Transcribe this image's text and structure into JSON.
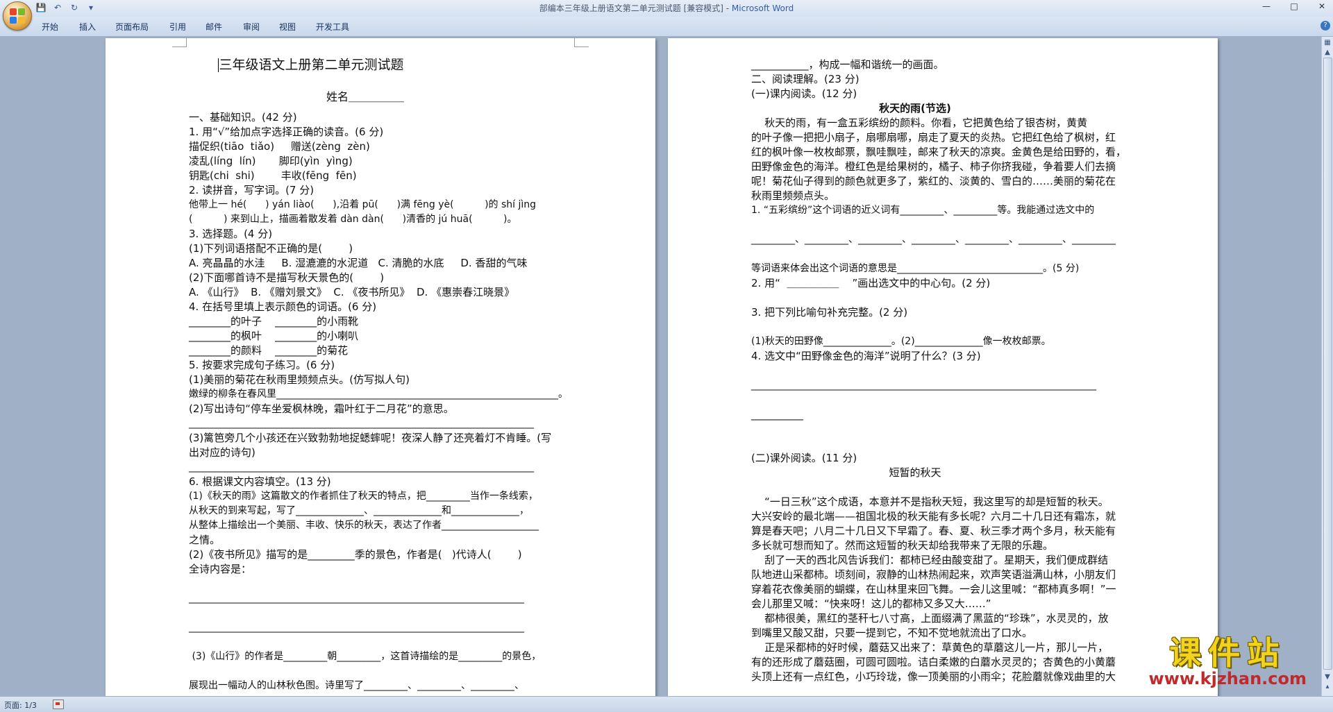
{
  "window": {
    "title": "部编本三年级上册语文第二单元测试题 [兼容模式] - ",
    "app_name": "Microsoft Word"
  },
  "ribbon": {
    "tabs": [
      "开始",
      "插入",
      "页面布局",
      "引用",
      "邮件",
      "审阅",
      "视图",
      "开发工具"
    ]
  },
  "status": {
    "page": "页面: 1/3"
  },
  "watermark": {
    "text": "课件站",
    "url": "www.kjzhan.com"
  },
  "page1": {
    "lines": [
      "三年级语文上册第二单元测试题",
      "姓名＿＿＿＿＿",
      "一、基础知识。(42 分)",
      "1. 用“√”给加点字选择正确的读音。(6 分)",
      "描促织(tiāo  tiǎo)     赠送(zèng  zèn)",
      "凌乱(líng  lín)       脚印(yìn  yìng)",
      "钥匙(chi  shi)        丰收(fēng  fēn)",
      "2. 读拼音，写字词。(7 分)",
      "他带上一 hé(      ) yán liào(      ),沿着 pū(      )满 fēng yè(          )的 shí jìng",
      "(          ) 来到山上，描画着散发着 dàn dàn(      )清香的 jú huā(          )。",
      "3. 选择题。(4 分)",
      "(1)下列词语搭配不正确的是(        )",
      "A. 亮晶晶的水洼     B. 湿漉漉的水泥道   C. 清脆的水底     D. 香甜的气味",
      "(2)下面哪首诗不是描写秋天景色的(        )",
      "A. 《山行》  B. 《赠刘景文》  C. 《夜书所见》  D. 《惠崇春江晓景》",
      "4. 在括号里填上表示颜色的词语。(6 分)",
      "________的叶子    ________的小雨靴",
      "________的枫叶    ________的小喇叭",
      "________的颜料    ________的菊花",
      "5. 按要求完成句子练习。(6 分)",
      "(1)美丽的菊花在秋雨里频频点头。(仿写拟人句)",
      "嫩绿的柳条在春风里__________________________________________________________。",
      "(2)写出诗句“停车坐爱枫林晚，霜叶红于二月花”的意思。",
      "_______________________________________________________________________",
      "(3)篱笆旁几个小孩还在兴致勃勃地捉蟋蟀呢！夜深人静了还亮着灯不肯睡。(写",
      "出对应的诗句)",
      "_______________________________________________________________________",
      "6. 根据课文内容填空。(13 分)",
      "(1)《秋天的雨》这篇散文的作者抓住了秋天的特点，把_________当作一条线索，",
      "从秋天的到来写起，写了______________、______________和______________，",
      "从整体上描绘出一个美丽、丰收、快乐的秋天，表达了作者____________________",
      "之情。",
      "(2)《夜书所见》描写的是_________季的景色，作者是(   )代诗人(        )",
      "全诗内容是：",
      "",
      "_____________________________________________________________________",
      "",
      "_____________________________________________________________________",
      "",
      " (3)《山行》的作者是_________朝_________，这首诗描绘的是_________的景色，",
      "",
      "展现出一幅动人的山林秋色图。诗里写了_________、_________、_________、"
    ]
  },
  "page2": {
    "lines": [
      "",
      "___________，构成一幅和谐统一的画面。",
      "二、阅读理解。(23 分)",
      "(一)课内阅读。(12 分)",
      "秋天的雨(节选)",
      "    秋天的雨，有一盒五彩缤纷的颜料。你看，它把黄色给了银杏树，黄黄",
      "的叶子像一把把小扇子，扇哪扇哪，扇走了夏天的炎热。它把红色给了枫树，红",
      "红的枫叶像一枚枚邮票，飘哇飘哇，邮来了秋天的凉爽。金黄色是给田野的，看，",
      "田野像金色的海洋。橙红色是给果树的，橘子、柿子你挤我碰，争着要人们去摘",
      "呢！菊花仙子得到的颜色就更多了，紫红的、淡黄的、雪白的……美丽的菊花在",
      "秋雨里频频点头。",
      "1. “五彩缤纷”这个词语的近义词有_________、_________等。我能通过选文中的",
      "",
      "_________、_________、_________、_________、_________、_________、_________",
      "",
      "等词语来体会出这个词语的意思是______________________________。(5 分)",
      "2. 用“  ＿＿＿＿＿    ”画出选文中的中心句。(2 分)",
      "",
      "3. 把下列比喻句补充完整。(2 分)",
      "",
      "(1)秋天的田野像______________。(2)______________像一枚枚邮票。",
      "4. 选文中“田野像金色的海洋”说明了什么？(3 分)",
      "",
      "_______________________________________________________________________",
      "",
      "__________",
      "",
      "",
      "(二)课外阅读。(11 分)",
      "短暂的秋天",
      "",
      "    “一日三秋”这个成语，本意并不是指秋天短，我这里写的却是短暂的秋天。",
      "大兴安岭的最北端——祖国北极的秋天能有多长呢？六月二十几日还有霜冻，就",
      "算是春天吧；八月二十几日又下早霜了。春、夏、秋三季才两个多月，秋天能有",
      "多长就可想而知了。然而这短暂的秋天却给我带来了无限的乐趣。",
      "    刮了一天的西北风告诉我们：都柿已经由酸变甜了。星期天，我们便成群结",
      "队地进山采都柿。顷刻间，寂静的山林热闹起来，欢声笑语溢满山林，小朋友们",
      "穿着花衣像美丽的蝴蝶，在山林里来回飞舞。一会儿这里喊：“都柿真多啊！”一",
      "会儿那里又喊：“快来呀！这儿的都柿又多又大……”",
      "    都柿很美，黑红的茎秆七八寸高，上面缀满了黑蓝的“珍珠”，水灵灵的，放",
      "到嘴里又酸又甜，只要一提到它，不知不觉地就流出了口水。",
      "    正是采都柿的好时候，蘑菇又出来了：草黄色的草蘑这儿一片，那儿一片，",
      "有的还形成了蘑菇圈，可圆可圆啦。诘白柔嫩的白蘑水灵灵的；杏黄色的小黄蘑",
      "头顶上还有一点红色，小巧玲珑，像一顶美丽的小雨伞；花脸蘑就像戏曲里的大"
    ]
  }
}
